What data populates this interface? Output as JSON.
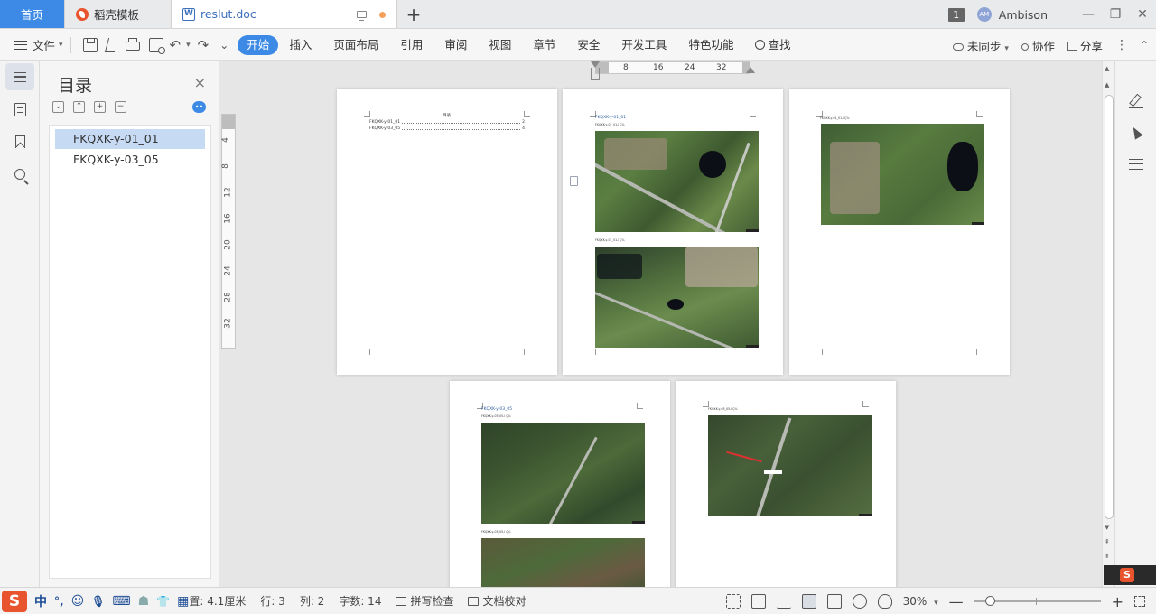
{
  "tabs": {
    "home": "首页",
    "template": "稻壳模板",
    "document": "reslut.doc",
    "add": "+"
  },
  "titlebar": {
    "window_count": "1",
    "avatar_initials": "AM",
    "user": "Ambison",
    "minimize": "—",
    "restore": "❐",
    "close": "✕"
  },
  "menubar": {
    "file": "文件",
    "undo": "↶",
    "redo": "↷",
    "more": "⌄",
    "items": [
      "开始",
      "插入",
      "页面布局",
      "引用",
      "审阅",
      "视图",
      "章节",
      "安全",
      "开发工具",
      "特色功能",
      "查找"
    ],
    "active_index": 0,
    "sync": "未同步",
    "collaborate": "协作",
    "share": "分享",
    "kebab": "⋮",
    "collapse": "⌃"
  },
  "toc": {
    "title": "目录",
    "close": "×",
    "tools": [
      "⌄",
      "⌃",
      "+",
      "−"
    ],
    "ai_badge": "••",
    "items": [
      "FKQXK-y-01_01",
      "FKQXK-y-03_05"
    ],
    "selected_index": 0
  },
  "rulers": {
    "vertical": [
      "4",
      "8",
      "12",
      "16",
      "20",
      "24",
      "28",
      "32"
    ],
    "horizontal": [
      "8",
      "16",
      "24",
      "32"
    ]
  },
  "pages": {
    "p1": {
      "title": "目录",
      "toc_lines": [
        {
          "name": "FKQXK-y-01_01",
          "page": "2"
        },
        {
          "name": "FKQXK-y-03_05",
          "page": "4"
        }
      ]
    },
    "p2": {
      "heading": "FKQXK-y-01_01",
      "caption1": "FKQXK-y-01_01-ì Ç¾",
      "caption2": "FKQXK-y-01_01-ì Ç¾"
    },
    "p3": {
      "caption": "FKQXK-y-01_01-ì Ç¾"
    },
    "p4": {
      "heading": "FKQXK-y-03_05",
      "caption1": "FKQXK-y-03_05-ì Ç¾",
      "caption2": "FKQXK-y-03_05-ì Ç¾"
    },
    "p5": {
      "caption": "FKQXK-y-03_05-ì Ç¾"
    }
  },
  "scroll": {
    "up": "▲",
    "down": "▼",
    "page_up": "⇞",
    "page_down": "⇟"
  },
  "ime": {
    "logo": "S",
    "chinese": "中",
    "punct": "°,",
    "emoji": "☺",
    "mic": "🎙",
    "keyboard": "⌨",
    "user": "☗",
    "skin": "👕",
    "grid": "▦"
  },
  "statusbar": {
    "position": "置: 4.1厘米",
    "line": "行: 3",
    "column": "列: 2",
    "word_count": "字数: 14",
    "spellcheck": "拼写检查",
    "proofread": "文档校对",
    "zoom": "30%",
    "zoom_minus": "—",
    "zoom_plus": "+"
  },
  "colors": {
    "accent": "#3d8ae6",
    "toc_selected": "#c7daf4",
    "brand_orange": "#e8542d"
  }
}
